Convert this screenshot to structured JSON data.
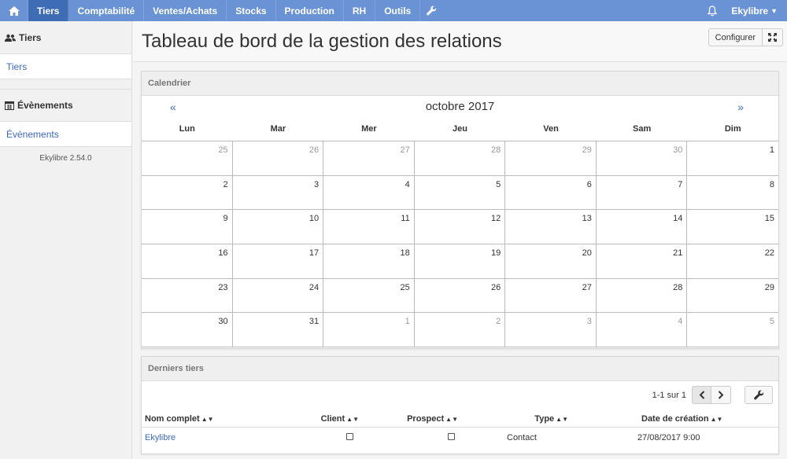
{
  "nav": {
    "items": [
      {
        "label": "Tiers",
        "active": true
      },
      {
        "label": "Comptabilité"
      },
      {
        "label": "Ventes/Achats"
      },
      {
        "label": "Stocks"
      },
      {
        "label": "Production"
      },
      {
        "label": "RH"
      },
      {
        "label": "Outils"
      }
    ],
    "user": "Ekylibre",
    "icons": [
      "home-icon",
      "wrench-icon",
      "bell-icon"
    ],
    "bar_color": "#6a93d6",
    "active_color": "#3f6db5"
  },
  "sidebar": {
    "sections": [
      {
        "title": "Tiers",
        "icon": "people-icon",
        "links": [
          "Tiers"
        ]
      },
      {
        "title": "Évènements",
        "icon": "calendar-icon",
        "links": [
          "Évènements"
        ]
      }
    ],
    "version": "Ekylibre 2.54.0"
  },
  "page": {
    "title": "Tableau de bord de la gestion des relations",
    "configure_label": "Configurer"
  },
  "calendar": {
    "panel_title": "Calendrier",
    "prev": "«",
    "next": "»",
    "month": "octobre 2017",
    "weekdays": [
      "Lun",
      "Mar",
      "Mer",
      "Jeu",
      "Ven",
      "Sam",
      "Dim"
    ],
    "weeks": [
      [
        "25",
        "26",
        "27",
        "28",
        "29",
        "30",
        "1"
      ],
      [
        "2",
        "3",
        "4",
        "5",
        "6",
        "7",
        "8"
      ],
      [
        "9",
        "10",
        "11",
        "12",
        "13",
        "14",
        "15"
      ],
      [
        "16",
        "17",
        "18",
        "19",
        "20",
        "21",
        "22"
      ],
      [
        "23",
        "24",
        "25",
        "26",
        "27",
        "28",
        "29"
      ],
      [
        "30",
        "31",
        "1",
        "2",
        "3",
        "4",
        "5"
      ]
    ],
    "other_month_cells": [
      [
        0,
        0
      ],
      [
        0,
        1
      ],
      [
        0,
        2
      ],
      [
        0,
        3
      ],
      [
        0,
        4
      ],
      [
        0,
        5
      ],
      [
        5,
        2
      ],
      [
        5,
        3
      ],
      [
        5,
        4
      ],
      [
        5,
        5
      ],
      [
        5,
        6
      ]
    ]
  },
  "latest": {
    "panel_title": "Derniers tiers",
    "pager_text": "1-1 sur 1",
    "columns": [
      "Nom complet",
      "Client",
      "Prospect",
      "Type",
      "Date de création"
    ],
    "rows": [
      {
        "name": "Ekylibre",
        "client": false,
        "prospect": false,
        "type": "Contact",
        "created": "27/08/2017 9:00"
      }
    ]
  }
}
